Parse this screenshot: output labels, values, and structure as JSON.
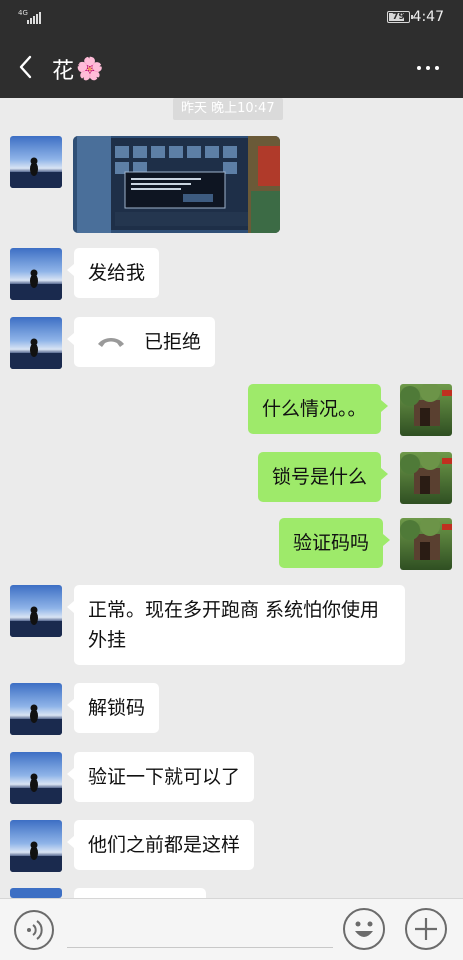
{
  "status_bar": {
    "network": "4G",
    "battery": "79",
    "battery_level": 0.79,
    "time": "4:47"
  },
  "header": {
    "title": "花",
    "title_emoji": "🌸",
    "back_icon": "chevron-left-icon",
    "more_icon": "more-horizontal-icon"
  },
  "timestamp": "昨天 晚上10:47",
  "messages": [
    {
      "side": "in",
      "type": "image"
    },
    {
      "side": "in",
      "type": "text",
      "text": "发给我"
    },
    {
      "side": "in",
      "type": "call",
      "text": "已拒绝",
      "icon": "phone-icon"
    },
    {
      "side": "out",
      "type": "text",
      "text": "什么情况。。"
    },
    {
      "side": "out",
      "type": "text",
      "text": "锁号是什么"
    },
    {
      "side": "out",
      "type": "text",
      "text": "验证码吗"
    },
    {
      "side": "in",
      "type": "text",
      "text": "正常。现在多开跑商 系统怕你使用外挂"
    },
    {
      "side": "in",
      "type": "text",
      "text": "解锁码"
    },
    {
      "side": "in",
      "type": "text",
      "text": "验证一下就可以了"
    },
    {
      "side": "in",
      "type": "text",
      "text": "他们之前都是这样"
    }
  ],
  "input_bar": {
    "voice_icon": "voice-icon",
    "emoji_icon": "emoji-icon",
    "plus_icon": "plus-icon"
  },
  "colors": {
    "header_bg": "#2e2e2e",
    "chat_bg": "#ebebeb",
    "incoming_bubble": "#ffffff",
    "outgoing_bubble": "#9eea6a"
  }
}
